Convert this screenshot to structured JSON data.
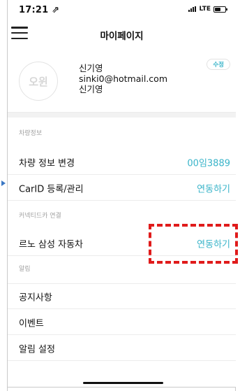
{
  "status_bar": {
    "time": "17:21 ⇗",
    "network": "LTE"
  },
  "header": {
    "title": "마이페이지"
  },
  "profile": {
    "avatar_text": "오윈",
    "name": "신기영",
    "email": "sinki0@hotmail.com",
    "nickname": "신기영",
    "edit_label": "수정"
  },
  "sections": {
    "vehicle_header": "차량정보",
    "connected_header": "커넥티드카 연결",
    "alerts_header": "알림"
  },
  "rows": {
    "vehicle_change": {
      "label": "차량 정보 변경",
      "value": "00임3889"
    },
    "carid": {
      "label": "CarID 등록/관리",
      "value": "연동하기"
    },
    "renault": {
      "label": "르노 삼성 자동차",
      "value": "연동하기"
    },
    "notice": {
      "label": "공지사항"
    },
    "event": {
      "label": "이벤트"
    },
    "alarm_settings": {
      "label": "알림 설정"
    }
  },
  "colors": {
    "accent": "#39b4c9",
    "highlight_box": "#e01b1b",
    "pointer": "#3b78c4"
  },
  "icons": {
    "menu": "hamburger-menu-icon",
    "signal": "signal-icon",
    "battery": "battery-icon"
  }
}
